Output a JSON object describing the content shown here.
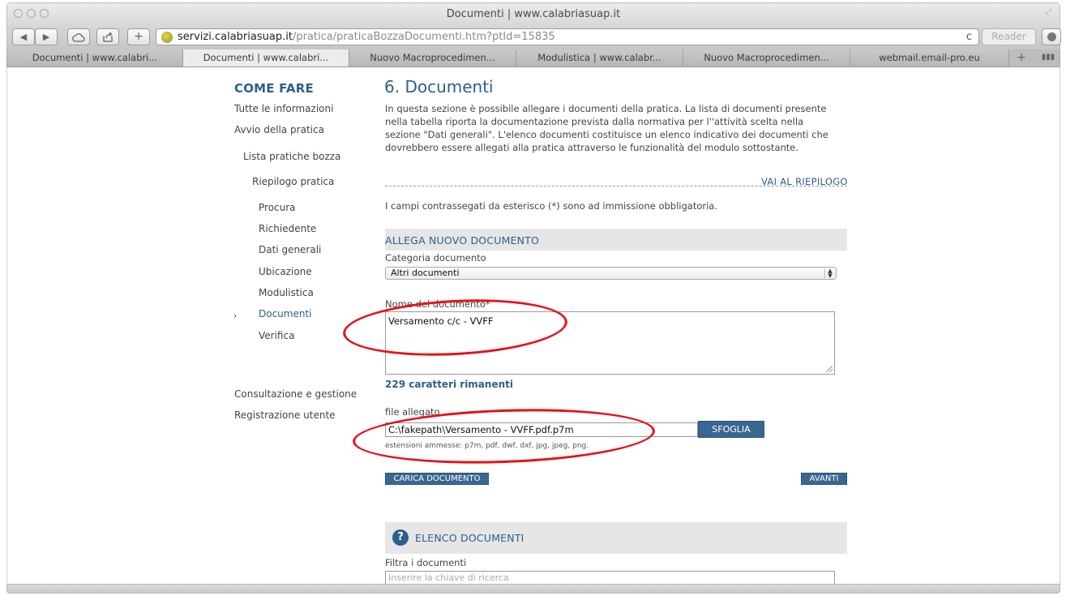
{
  "window": {
    "title": "Documenti | www.calabriasuap.it"
  },
  "toolbar": {
    "back": "◀",
    "forward": "▶",
    "plus": "+",
    "url_host": "servizi.calabriasuap.it",
    "url_path": "/pratica/praticaBozzaDocumenti.htm?ptId=15835",
    "reload": "c",
    "reader": "Reader"
  },
  "tabs": [
    {
      "label": "Documenti | www.calabri..."
    },
    {
      "label": "Documenti | www.calabri..."
    },
    {
      "label": "Nuovo Macroprocedimen..."
    },
    {
      "label": "Modulistica | www.calabr..."
    },
    {
      "label": "Nuovo Macroprocedimen..."
    },
    {
      "label": "webmail.email-pro.eu"
    }
  ],
  "sidebar": {
    "title": "COME FARE",
    "items": [
      {
        "label": "Tutte le informazioni"
      },
      {
        "label": "Avvio della pratica"
      },
      {
        "label": "Lista pratiche bozza"
      },
      {
        "label": "Riepilogo pratica"
      },
      {
        "label": "Procura"
      },
      {
        "label": "Richiedente"
      },
      {
        "label": "Dati generali"
      },
      {
        "label": "Ubicazione"
      },
      {
        "label": "Modulistica"
      },
      {
        "label": "Documenti"
      },
      {
        "label": "Verifica"
      },
      {
        "label": "Consultazione e gestione"
      },
      {
        "label": "Registrazione utente"
      }
    ],
    "current_marker": "›"
  },
  "main": {
    "title": "6. Documenti",
    "intro": "In questa sezione è possibile allegare i documenti della pratica. La lista di documenti presente nella tabella riporta la documentazione prevista dalla normativa per l''attività scelta nella sezione \"Dati generali\". L'elenco documenti costituisce un elenco indicativo dei documenti che dovrebbero essere allegati alla pratica attraverso le funzionalità del modulo sottostante.",
    "riepilogo_link": "VAI AL RIEPILOGO",
    "required_note": "I campi contrassegati da esterisco (*) sono ad immissione obbligatoria.",
    "allega": {
      "section_title": "ALLEGA NUOVO DOCUMENTO",
      "categoria_label": "Categoria documento",
      "categoria_value": "Altri documenti",
      "nome_label": "Nome del documento*",
      "nome_value": "Versamento c/c - VVFF",
      "chars_remaining": "229 caratteri rimanenti",
      "file_label": "file allegato",
      "file_value": "C:\\fakepath\\Versamento - VVFF.pdf.p7m",
      "sfoglia": "SFOGLIA",
      "extensions": "estensioni ammesse: p7m, pdf, dwf, dxf, jpg, jpeg, png.",
      "carica": "CARICA DOCUMENTO",
      "avanti": "AVANTI"
    },
    "elenco": {
      "section_title": "ELENCO DOCUMENTI",
      "filter_label": "Filtra i documenti",
      "filter_placeholder": "Inserire la chiave di ricerca"
    }
  },
  "colors": {
    "accent": "#2d5f8a",
    "button": "#3a6791",
    "annotation": "#e4131b"
  }
}
